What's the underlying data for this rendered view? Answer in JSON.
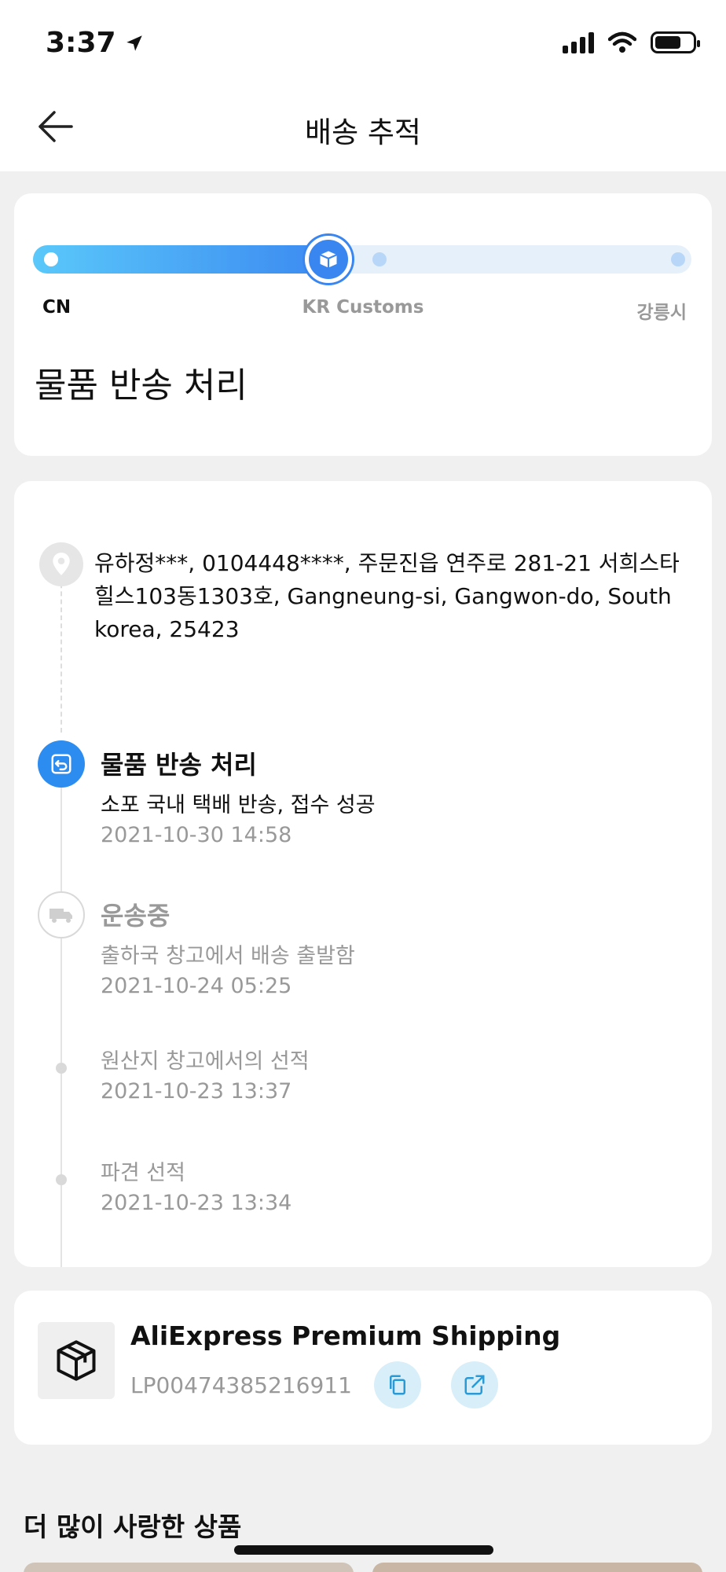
{
  "status_bar": {
    "time": "3:37"
  },
  "header": {
    "title": "배송 추적"
  },
  "progress": {
    "stages": {
      "origin": "CN",
      "current": "KR Customs",
      "destination": "강릉시"
    },
    "status": "물품 반송 처리"
  },
  "timeline": {
    "address": "유하정***,  0104448****,  주문진읍 연주로 281-21 서희스타힐스103동1303호,  Gangneung-si,  Gangwon-do,  South korea,  25423",
    "events": [
      {
        "title": "물품 반송 처리",
        "desc": "소포 국내 택배 반송, 접수 성공",
        "date": "2021-10-30 14:58"
      },
      {
        "title": "운송중",
        "desc": "출하국 창고에서 배송 출발함",
        "date": "2021-10-24 05:25"
      },
      {
        "title": "",
        "desc": "원산지 창고에서의 선적",
        "date": "2021-10-23 13:37"
      },
      {
        "title": "",
        "desc": "파견 선적",
        "date": "2021-10-23 13:34"
      }
    ]
  },
  "carrier": {
    "name": "AliExpress Premium Shipping",
    "tracking_number": "LP00474385216911"
  },
  "recommend": {
    "title": "더 많이 사랑한 상품"
  },
  "colors": {
    "accent": "#3a86f0",
    "progress_start": "#5ac8fa",
    "muted": "#999999"
  }
}
